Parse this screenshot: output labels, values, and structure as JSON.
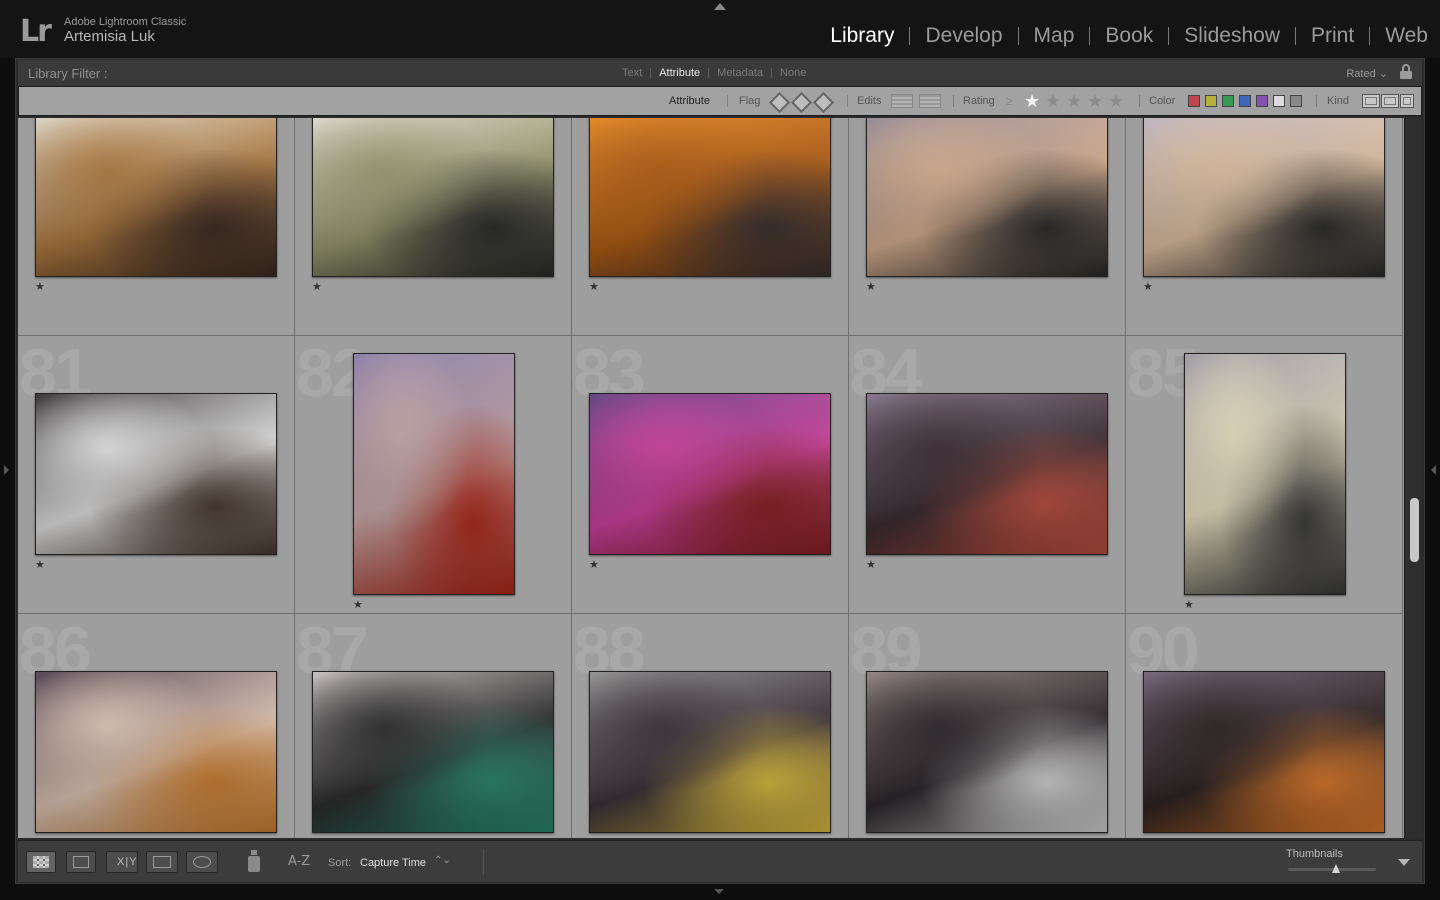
{
  "identity": {
    "logo": "Lr",
    "app_name": "Adobe Lightroom Classic",
    "user_name": "Artemisia Luk"
  },
  "modules": [
    {
      "label": "Library",
      "active": true
    },
    {
      "label": "Develop",
      "active": false
    },
    {
      "label": "Map",
      "active": false
    },
    {
      "label": "Book",
      "active": false
    },
    {
      "label": "Slideshow",
      "active": false
    },
    {
      "label": "Print",
      "active": false
    },
    {
      "label": "Web",
      "active": false
    }
  ],
  "filter_bar": {
    "title": "Library Filter :",
    "tabs": [
      {
        "label": "Text",
        "active": false
      },
      {
        "label": "Attribute",
        "active": true
      },
      {
        "label": "Metadata",
        "active": false
      },
      {
        "label": "None",
        "active": false
      }
    ],
    "preset": "Rated"
  },
  "attribute_bar": {
    "attribute_label": "Attribute",
    "flag_label": "Flag",
    "edits_label": "Edits",
    "rating_label": "Rating",
    "rating_operator": "≥",
    "rating_stars": 1,
    "color_label": "Color",
    "color_swatches": [
      "#c0454f",
      "#b6b13d",
      "#3a9a55",
      "#3e67b5",
      "#8552b0",
      "#dcdcdc",
      "#8a8a8a"
    ],
    "kind_label": "Kind"
  },
  "grid": {
    "rows": [
      {
        "cells": [
          {
            "number": "",
            "rating": 1,
            "orientation": "landscape",
            "colors": [
              "#d8d2c4",
              "#b07a3e",
              "#3c2a22"
            ]
          },
          {
            "number": "",
            "rating": 1,
            "orientation": "landscape",
            "colors": [
              "#d9d4c8",
              "#9a9a70",
              "#2a2a2a"
            ]
          },
          {
            "number": "",
            "rating": 1,
            "orientation": "landscape",
            "colors": [
              "#e08018",
              "#b25c12",
              "#3a3030"
            ]
          },
          {
            "number": "",
            "rating": 1,
            "orientation": "landscape",
            "colors": [
              "#8e8390",
              "#d8b090",
              "#2a2a2a"
            ]
          },
          {
            "number": "",
            "rating": 1,
            "orientation": "landscape",
            "colors": [
              "#b8b0bc",
              "#e0c0a0",
              "#2a2a2a"
            ]
          }
        ]
      },
      {
        "cells": [
          {
            "number": "81",
            "rating": 1,
            "orientation": "landscape",
            "colors": [
              "#2e2a2c",
              "#e6e6e6",
              "#4a3a30"
            ]
          },
          {
            "number": "82",
            "rating": 1,
            "orientation": "portrait",
            "colors": [
              "#8478a0",
              "#c8a8a8",
              "#b0281a"
            ]
          },
          {
            "number": "83",
            "rating": 1,
            "orientation": "landscape",
            "colors": [
              "#5a3a78",
              "#d040a0",
              "#8a2020"
            ]
          },
          {
            "number": "84",
            "rating": 1,
            "orientation": "landscape",
            "colors": [
              "#7a6a80",
              "#3a2a30",
              "#c05040"
            ]
          },
          {
            "number": "85",
            "rating": 1,
            "orientation": "portrait",
            "colors": [
              "#9a96a0",
              "#e8e0c0",
              "#3a3a3a"
            ]
          }
        ]
      },
      {
        "cells": [
          {
            "number": "86",
            "rating": 0,
            "orientation": "landscape",
            "colors": [
              "#4a3a48",
              "#e0c8b8",
              "#d08030"
            ]
          },
          {
            "number": "87",
            "rating": 0,
            "orientation": "landscape",
            "colors": [
              "#c0b8b8",
              "#2a2a2a",
              "#2a8a70"
            ]
          },
          {
            "number": "88",
            "rating": 0,
            "orientation": "landscape",
            "colors": [
              "#8a8a8a",
              "#3a3038",
              "#e0c040"
            ]
          },
          {
            "number": "89",
            "rating": 0,
            "orientation": "landscape",
            "colors": [
              "#8a7a78",
              "#2a2428",
              "#d8d8d8"
            ]
          },
          {
            "number": "90",
            "rating": 0,
            "orientation": "landscape",
            "colors": [
              "#6a5a70",
              "#2a2020",
              "#e07a2a"
            ]
          }
        ]
      }
    ]
  },
  "toolbar": {
    "xy_label": "X|Y",
    "sort_label": "Sort:",
    "sort_value": "Capture Time",
    "sort_chevron": "⌃⌄",
    "sort_icon": "A-Z",
    "thumbnails_label": "Thumbnails",
    "thumbnail_size": 0.55
  }
}
